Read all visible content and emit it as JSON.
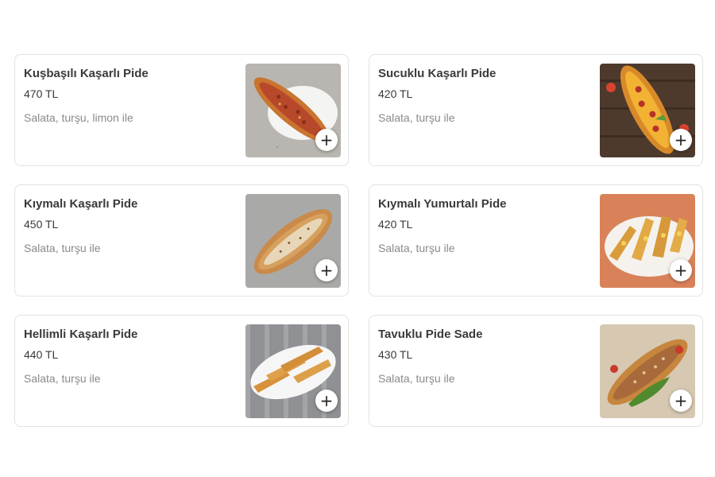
{
  "menu": {
    "items": [
      {
        "title": "Kuşbaşılı Kaşarlı Pide",
        "price": "470 TL",
        "description": "Salata, turşu, limon ile",
        "image": "pide-kusbasi-photo",
        "add_symbol": "+"
      },
      {
        "title": "Sucuklu Kaşarlı Pide",
        "price": "420 TL",
        "description": "Salata, turşu ile",
        "image": "pide-sucuk-photo",
        "add_symbol": "+"
      },
      {
        "title": "Kıymalı Kaşarlı Pide",
        "price": "450 TL",
        "description": "Salata, turşu ile",
        "image": "pide-kiyma-photo",
        "add_symbol": "+"
      },
      {
        "title": "Kıymalı Yumurtalı Pide",
        "price": "420 TL",
        "description": "Salata, turşu ile",
        "image": "pide-yumurta-photo",
        "add_symbol": "+"
      },
      {
        "title": "Hellimli Kaşarlı Pide",
        "price": "440 TL",
        "description": "Salata, turşu ile",
        "image": "pide-hellim-photo",
        "add_symbol": "+"
      },
      {
        "title": "Tavuklu Pide Sade",
        "price": "430 TL",
        "description": "Salata, turşu ile",
        "image": "pide-tavuk-photo",
        "add_symbol": "+"
      }
    ]
  },
  "colors": {
    "title_text": "#3a3a3a",
    "description_text": "#8a8a8a",
    "card_border": "#e2e2e2"
  }
}
